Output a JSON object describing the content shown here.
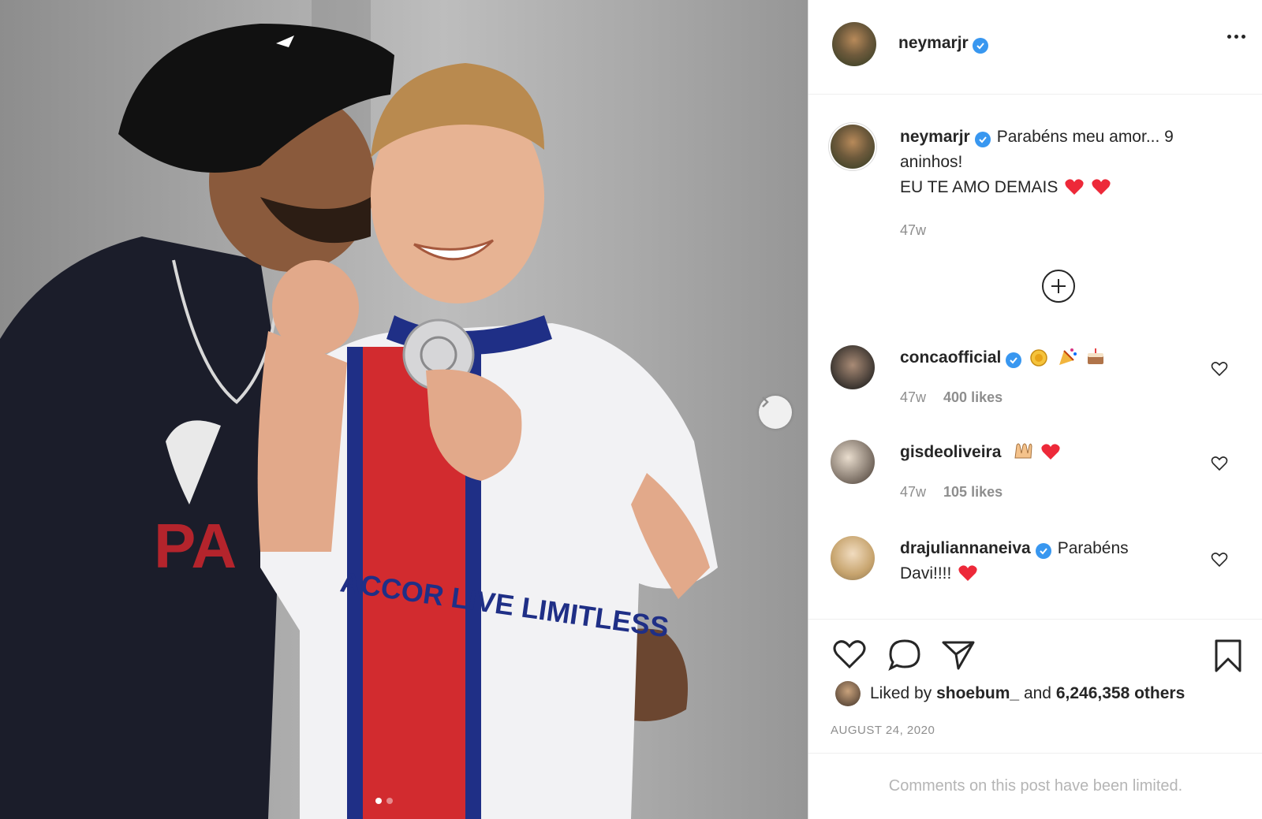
{
  "post": {
    "author": "neymarjr",
    "caption_line1": "Parabéns meu amor... 9",
    "caption_line2": "aninhos!",
    "caption_line3": "EU TE AMO DEMAIS",
    "caption_time": "47w",
    "photo": {
      "jersey_text": "ACCOR LIVE LIMITLESS",
      "carousel_index": 1,
      "carousel_count": 2
    }
  },
  "comments": [
    {
      "username": "concaofficial",
      "verified": true,
      "text": "",
      "time": "47w",
      "likes": "400 likes"
    },
    {
      "username": "gisdeoliveira",
      "verified": false,
      "text": "",
      "time": "47w",
      "likes": "105 likes"
    },
    {
      "username": "drajuliannaneiva",
      "verified": true,
      "text_line1": "Parabéns",
      "text_line2": "Davi!!!!"
    }
  ],
  "likes": {
    "prefix": "Liked by",
    "user": "shoebum_",
    "conjunction": "and",
    "others": "6,246,358 others"
  },
  "date": "AUGUST 24, 2020",
  "footer": "Comments on this post have been limited.",
  "icons": {
    "verified": "verified-badge-icon",
    "more": "more-options-icon",
    "load": "plus-circle-icon",
    "like": "heart-icon",
    "comment": "comment-bubble-icon",
    "share": "paper-plane-icon",
    "save": "bookmark-icon",
    "next": "chevron-right-icon"
  },
  "colors": {
    "verified": "#3897f0",
    "heart_red": "#ed4956",
    "text": "#262626",
    "muted": "#8e8e8e"
  }
}
